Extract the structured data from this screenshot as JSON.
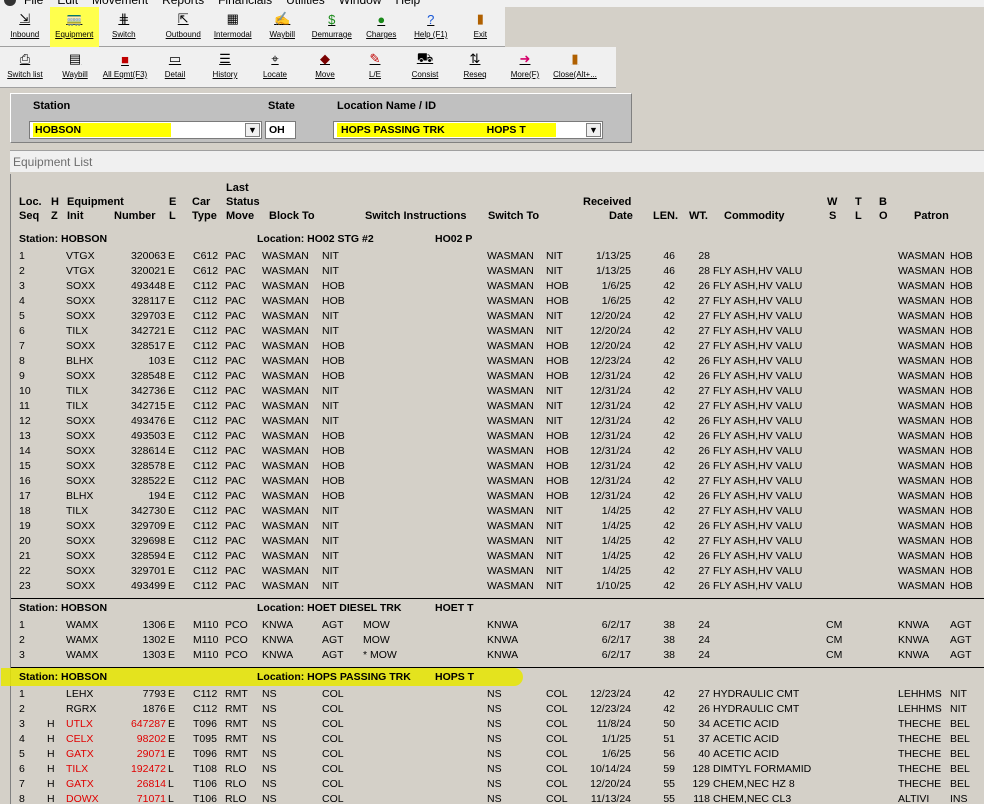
{
  "menu": [
    "File",
    "Edit",
    "Movement",
    "Reports",
    "Financials",
    "Utilities",
    "Window",
    "Help"
  ],
  "toolbar1": [
    {
      "label": "Inbound",
      "icon": "inbound-icon",
      "glyph": "⇲"
    },
    {
      "label": "Equipment",
      "icon": "railcar-icon",
      "glyph": "🚃",
      "highlight": true
    },
    {
      "label": "Switch",
      "icon": "track-switch-icon",
      "glyph": "⋕"
    },
    {
      "label": "Outbound",
      "icon": "outbound-icon",
      "glyph": "⇱"
    },
    {
      "label": "Intermodal",
      "icon": "intermodal-icon",
      "glyph": "▦"
    },
    {
      "label": "Waybill",
      "icon": "waybill-icon",
      "glyph": "✍"
    },
    {
      "label": "Demurrage",
      "icon": "dollar-icon",
      "glyph": "$"
    },
    {
      "label": "Charges",
      "icon": "money-bag-icon",
      "glyph": "●"
    },
    {
      "label": "Help (F1)",
      "icon": "help-icon",
      "glyph": "?"
    },
    {
      "label": "Exit",
      "icon": "exit-door-icon",
      "glyph": "▮"
    }
  ],
  "toolbar2": [
    {
      "label": "Switch list",
      "icon": "printer-icon",
      "glyph": "⎙"
    },
    {
      "label": "Waybill",
      "icon": "document-icon",
      "glyph": "▤"
    },
    {
      "label": "All Eqmt(F3)",
      "icon": "all-equipment-icon",
      "glyph": "■"
    },
    {
      "label": "Detail",
      "icon": "detail-icon",
      "glyph": "▭"
    },
    {
      "label": "History",
      "icon": "history-icon",
      "glyph": "☰"
    },
    {
      "label": "Locate",
      "icon": "locate-icon",
      "glyph": "⌖"
    },
    {
      "label": "Move",
      "icon": "move-icon",
      "glyph": "◆"
    },
    {
      "label": "L/E",
      "icon": "load-empty-icon",
      "glyph": "✎"
    },
    {
      "label": "Consist",
      "icon": "consist-icon",
      "glyph": "⛟"
    },
    {
      "label": "Reseq",
      "icon": "resequence-icon",
      "glyph": "⇅"
    },
    {
      "label": "More(F)",
      "icon": "more-arrow-icon",
      "glyph": "➜"
    },
    {
      "label": "Close(Alt+...",
      "icon": "close-door-icon",
      "glyph": "▮"
    }
  ],
  "filter": {
    "station_label": "Station",
    "state_label": "State",
    "location_label": "Location Name / ID",
    "station_value": "HOBSON",
    "state_value": "OH",
    "location_value": "HOPS PASSING TRK",
    "location_id": "HOPS  T"
  },
  "list_title": "Equipment List",
  "headers": {
    "loc": "Loc.",
    "seq": "Seq",
    "h": "H",
    "z": "Z",
    "equipment": "Equipment",
    "init": "Init",
    "number": "Number",
    "e": "E",
    "l": "L",
    "car": "Car",
    "type": "Type",
    "last": "Last",
    "status": "Status",
    "move": "Move",
    "block_to": "Block To",
    "switch_instructions": "Switch Instructions",
    "switch_to": "Switch To",
    "received": "Received",
    "date": "Date",
    "len": "LEN.",
    "wt": "WT.",
    "commodity": "Commodity",
    "w": "W",
    "s": "S",
    "t": "T",
    "l2": "L",
    "b": "B",
    "o": "O",
    "patron": "Patron"
  },
  "sections": [
    {
      "station": "Station: HOBSON",
      "location": "Location: HO02 STG #2",
      "location_id": "HO02  P",
      "rows": [
        [
          "1",
          "",
          "VTGX",
          "320063",
          "E",
          "C612",
          "PAC",
          "WASMAN",
          "NIT",
          "",
          "WASMAN",
          "NIT",
          "1/13/25",
          "46",
          "28",
          "",
          "",
          "WASMAN",
          "HOB",
          ""
        ],
        [
          "2",
          "",
          "VTGX",
          "320021",
          "E",
          "C612",
          "PAC",
          "WASMAN",
          "NIT",
          "",
          "WASMAN",
          "NIT",
          "1/13/25",
          "46",
          "28",
          "FLY ASH,HV VALU",
          "",
          "WASMAN",
          "HOB",
          ""
        ],
        [
          "3",
          "",
          "SOXX",
          "493448",
          "E",
          "C112",
          "PAC",
          "WASMAN",
          "HOB",
          "",
          "WASMAN",
          "HOB",
          "1/6/25",
          "42",
          "26",
          "FLY ASH,HV VALU",
          "",
          "WASMAN",
          "HOB",
          ""
        ],
        [
          "4",
          "",
          "SOXX",
          "328117",
          "E",
          "C112",
          "PAC",
          "WASMAN",
          "HOB",
          "",
          "WASMAN",
          "HOB",
          "1/6/25",
          "42",
          "27",
          "FLY ASH,HV VALU",
          "",
          "WASMAN",
          "HOB",
          ""
        ],
        [
          "5",
          "",
          "SOXX",
          "329703",
          "E",
          "C112",
          "PAC",
          "WASMAN",
          "NIT",
          "",
          "WASMAN",
          "NIT",
          "12/20/24",
          "42",
          "27",
          "FLY ASH,HV VALU",
          "",
          "WASMAN",
          "HOB",
          ""
        ],
        [
          "6",
          "",
          "TILX",
          "342721",
          "E",
          "C112",
          "PAC",
          "WASMAN",
          "NIT",
          "",
          "WASMAN",
          "NIT",
          "12/20/24",
          "42",
          "27",
          "FLY ASH,HV VALU",
          "",
          "WASMAN",
          "HOB",
          ""
        ],
        [
          "7",
          "",
          "SOXX",
          "328517",
          "E",
          "C112",
          "PAC",
          "WASMAN",
          "HOB",
          "",
          "WASMAN",
          "HOB",
          "12/20/24",
          "42",
          "27",
          "FLY ASH,HV VALU",
          "",
          "WASMAN",
          "HOB",
          ""
        ],
        [
          "8",
          "",
          "BLHX",
          "103",
          "E",
          "C112",
          "PAC",
          "WASMAN",
          "HOB",
          "",
          "WASMAN",
          "HOB",
          "12/23/24",
          "42",
          "26",
          "FLY ASH,HV VALU",
          "",
          "WASMAN",
          "HOB",
          ""
        ],
        [
          "9",
          "",
          "SOXX",
          "328548",
          "E",
          "C112",
          "PAC",
          "WASMAN",
          "HOB",
          "",
          "WASMAN",
          "HOB",
          "12/31/24",
          "42",
          "26",
          "FLY ASH,HV VALU",
          "",
          "WASMAN",
          "HOB",
          ""
        ],
        [
          "10",
          "",
          "TILX",
          "342736",
          "E",
          "C112",
          "PAC",
          "WASMAN",
          "NIT",
          "",
          "WASMAN",
          "NIT",
          "12/31/24",
          "42",
          "27",
          "FLY ASH,HV VALU",
          "",
          "WASMAN",
          "HOB",
          ""
        ],
        [
          "11",
          "",
          "TILX",
          "342715",
          "E",
          "C112",
          "PAC",
          "WASMAN",
          "NIT",
          "",
          "WASMAN",
          "NIT",
          "12/31/24",
          "42",
          "27",
          "FLY ASH,HV VALU",
          "",
          "WASMAN",
          "HOB",
          ""
        ],
        [
          "12",
          "",
          "SOXX",
          "493476",
          "E",
          "C112",
          "PAC",
          "WASMAN",
          "NIT",
          "",
          "WASMAN",
          "NIT",
          "12/31/24",
          "42",
          "26",
          "FLY ASH,HV VALU",
          "",
          "WASMAN",
          "HOB",
          ""
        ],
        [
          "13",
          "",
          "SOXX",
          "493503",
          "E",
          "C112",
          "PAC",
          "WASMAN",
          "HOB",
          "",
          "WASMAN",
          "HOB",
          "12/31/24",
          "42",
          "26",
          "FLY ASH,HV VALU",
          "",
          "WASMAN",
          "HOB",
          ""
        ],
        [
          "14",
          "",
          "SOXX",
          "328614",
          "E",
          "C112",
          "PAC",
          "WASMAN",
          "HOB",
          "",
          "WASMAN",
          "HOB",
          "12/31/24",
          "42",
          "26",
          "FLY ASH,HV VALU",
          "",
          "WASMAN",
          "HOB",
          ""
        ],
        [
          "15",
          "",
          "SOXX",
          "328578",
          "E",
          "C112",
          "PAC",
          "WASMAN",
          "HOB",
          "",
          "WASMAN",
          "HOB",
          "12/31/24",
          "42",
          "26",
          "FLY ASH,HV VALU",
          "",
          "WASMAN",
          "HOB",
          ""
        ],
        [
          "16",
          "",
          "SOXX",
          "328522",
          "E",
          "C112",
          "PAC",
          "WASMAN",
          "HOB",
          "",
          "WASMAN",
          "HOB",
          "12/31/24",
          "42",
          "27",
          "FLY ASH,HV VALU",
          "",
          "WASMAN",
          "HOB",
          ""
        ],
        [
          "17",
          "",
          "BLHX",
          "194",
          "E",
          "C112",
          "PAC",
          "WASMAN",
          "HOB",
          "",
          "WASMAN",
          "HOB",
          "12/31/24",
          "42",
          "26",
          "FLY ASH,HV VALU",
          "",
          "WASMAN",
          "HOB",
          ""
        ],
        [
          "18",
          "",
          "TILX",
          "342730",
          "E",
          "C112",
          "PAC",
          "WASMAN",
          "NIT",
          "",
          "WASMAN",
          "NIT",
          "1/4/25",
          "42",
          "27",
          "FLY ASH,HV VALU",
          "",
          "WASMAN",
          "HOB",
          ""
        ],
        [
          "19",
          "",
          "SOXX",
          "329709",
          "E",
          "C112",
          "PAC",
          "WASMAN",
          "NIT",
          "",
          "WASMAN",
          "NIT",
          "1/4/25",
          "42",
          "26",
          "FLY ASH,HV VALU",
          "",
          "WASMAN",
          "HOB",
          ""
        ],
        [
          "20",
          "",
          "SOXX",
          "329698",
          "E",
          "C112",
          "PAC",
          "WASMAN",
          "NIT",
          "",
          "WASMAN",
          "NIT",
          "1/4/25",
          "42",
          "27",
          "FLY ASH,HV VALU",
          "",
          "WASMAN",
          "HOB",
          ""
        ],
        [
          "21",
          "",
          "SOXX",
          "328594",
          "E",
          "C112",
          "PAC",
          "WASMAN",
          "NIT",
          "",
          "WASMAN",
          "NIT",
          "1/4/25",
          "42",
          "26",
          "FLY ASH,HV VALU",
          "",
          "WASMAN",
          "HOB",
          ""
        ],
        [
          "22",
          "",
          "SOXX",
          "329701",
          "E",
          "C112",
          "PAC",
          "WASMAN",
          "NIT",
          "",
          "WASMAN",
          "NIT",
          "1/4/25",
          "42",
          "27",
          "FLY ASH,HV VALU",
          "",
          "WASMAN",
          "HOB",
          ""
        ],
        [
          "23",
          "",
          "SOXX",
          "493499",
          "E",
          "C112",
          "PAC",
          "WASMAN",
          "NIT",
          "",
          "WASMAN",
          "NIT",
          "1/10/25",
          "42",
          "26",
          "FLY ASH,HV VALU",
          "",
          "WASMAN",
          "HOB",
          ""
        ]
      ]
    },
    {
      "station": "Station: HOBSON",
      "location": "Location: HOET DIESEL TRK",
      "location_id": "HOET  T",
      "rows": [
        [
          "1",
          "",
          "WAMX",
          "1306",
          "E",
          "M110",
          "PCO",
          "KNWA",
          "AGT",
          "MOW",
          "KNWA",
          "",
          "6/2/17",
          "38",
          "24",
          "",
          "CM",
          "KNWA",
          "AGT",
          ""
        ],
        [
          "2",
          "",
          "WAMX",
          "1302",
          "E",
          "M110",
          "PCO",
          "KNWA",
          "AGT",
          "MOW",
          "KNWA",
          "",
          "6/2/17",
          "38",
          "24",
          "",
          "CM",
          "KNWA",
          "AGT",
          ""
        ],
        [
          "3",
          "",
          "WAMX",
          "1303",
          "E",
          "M110",
          "PCO",
          "KNWA",
          "AGT",
          "*  MOW",
          "KNWA",
          "",
          "6/2/17",
          "38",
          "24",
          "",
          "CM",
          "KNWA",
          "AGT",
          ""
        ]
      ]
    },
    {
      "station": "Station: HOBSON",
      "location": "Location: HOPS PASSING TRK",
      "location_id": "HOPS  T",
      "highlight": true,
      "rows": [
        [
          "1",
          "",
          "LEHX",
          "7793",
          "E",
          "C112",
          "RMT",
          "NS",
          "COL",
          "",
          "NS",
          "COL",
          "12/23/24",
          "42",
          "27",
          "HYDRAULIC CMT",
          "",
          "LEHHMS",
          "NIT",
          ""
        ],
        [
          "2",
          "",
          "RGRX",
          "1876",
          "E",
          "C112",
          "RMT",
          "NS",
          "COL",
          "",
          "NS",
          "COL",
          "12/23/24",
          "42",
          "26",
          "HYDRAULIC CMT",
          "",
          "LEHHMS",
          "NIT",
          ""
        ],
        [
          "3",
          "H",
          "UTLX",
          "647287",
          "E",
          "T096",
          "RMT",
          "NS",
          "COL",
          "",
          "NS",
          "COL",
          "11/8/24",
          "50",
          "34",
          "ACETIC ACID",
          "",
          "THECHE",
          "BEL",
          "red"
        ],
        [
          "4",
          "H",
          "CELX",
          "98202",
          "E",
          "T095",
          "RMT",
          "NS",
          "COL",
          "",
          "NS",
          "COL",
          "1/1/25",
          "51",
          "37",
          "ACETIC ACID",
          "",
          "THECHE",
          "BEL",
          "red"
        ],
        [
          "5",
          "H",
          "GATX",
          "29071",
          "E",
          "T096",
          "RMT",
          "NS",
          "COL",
          "",
          "NS",
          "COL",
          "1/6/25",
          "56",
          "40",
          "ACETIC ACID",
          "",
          "THECHE",
          "BEL",
          "red"
        ],
        [
          "6",
          "H",
          "TILX",
          "192472",
          "L",
          "T108",
          "RLO",
          "NS",
          "COL",
          "",
          "NS",
          "COL",
          "10/14/24",
          "59",
          "128",
          "DIMTYL FORMAMID",
          "",
          "THECHE",
          "BEL",
          "red"
        ],
        [
          "7",
          "H",
          "GATX",
          "26814",
          "L",
          "T106",
          "RLO",
          "NS",
          "COL",
          "",
          "NS",
          "COL",
          "12/20/24",
          "55",
          "129",
          "CHEM,NEC HZ 8",
          "",
          "THECHE",
          "BEL",
          "red"
        ],
        [
          "8",
          "H",
          "DOWX",
          "71071",
          "L",
          "T106",
          "RLO",
          "NS",
          "COL",
          "",
          "NS",
          "COL",
          "11/13/24",
          "55",
          "118",
          "CHEM,NEC CL3",
          "",
          "ALTIVI",
          "INS",
          "red"
        ]
      ]
    }
  ],
  "colors": {
    "highlight": "#ffff00",
    "hazmat": "#e00000",
    "panel": "#d4d0c8"
  }
}
